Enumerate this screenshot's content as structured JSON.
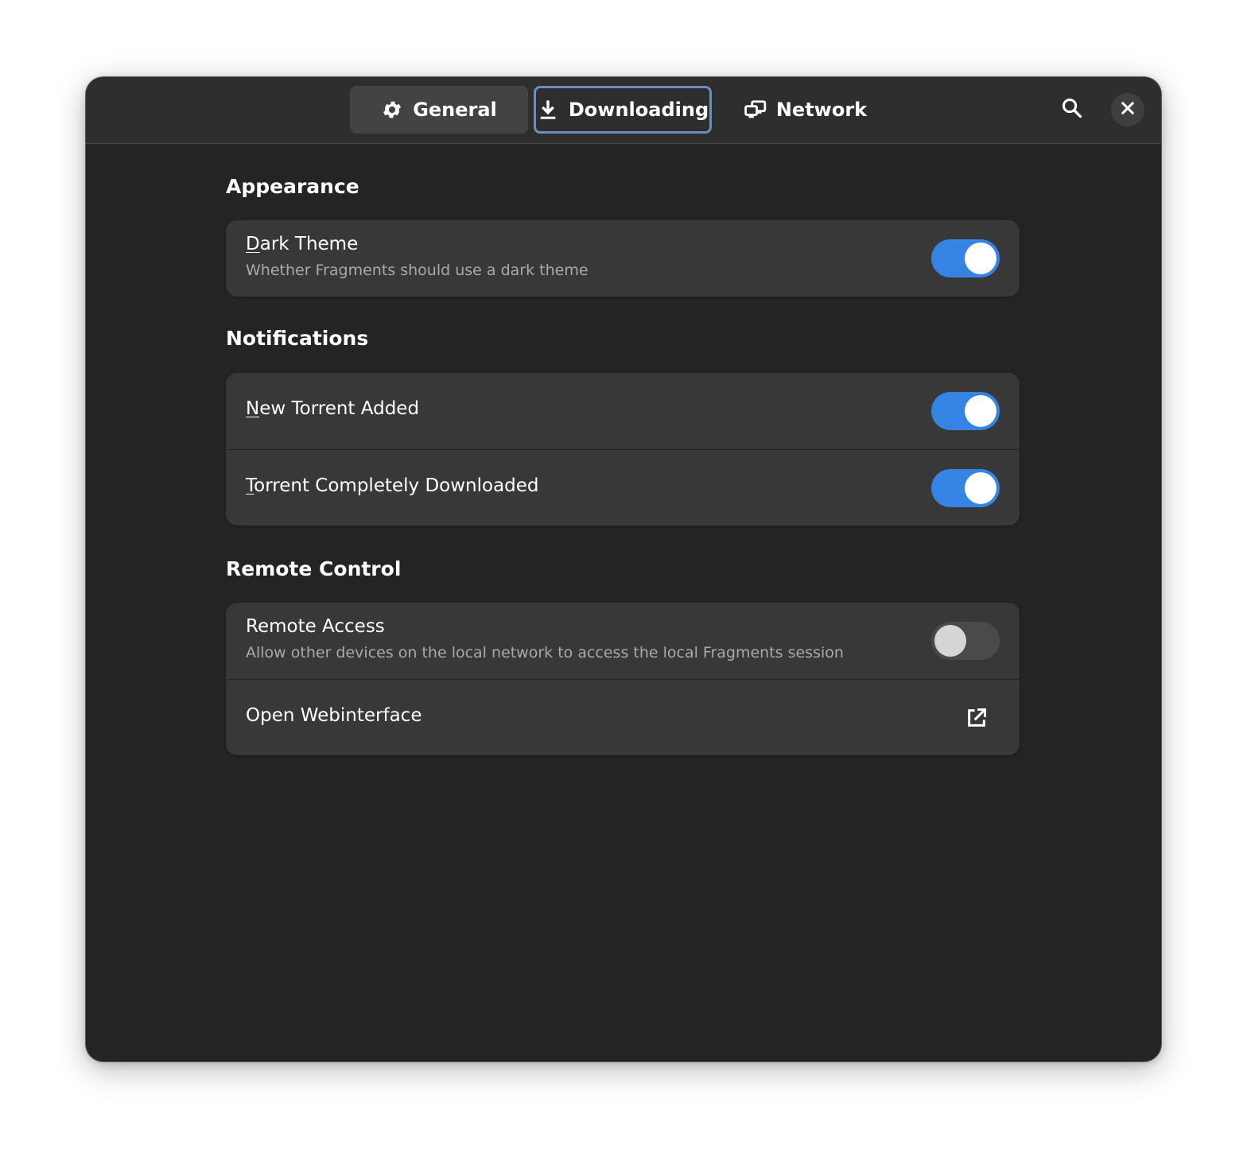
{
  "header": {
    "tabs": [
      {
        "label": "General",
        "icon": "gear-icon",
        "state": "hover"
      },
      {
        "label": "Downloading",
        "icon": "download-icon",
        "state": "focused"
      },
      {
        "label": "Network",
        "icon": "network-icon",
        "state": "normal"
      }
    ],
    "search_icon": "search-icon",
    "close_icon": "close-icon"
  },
  "sections": {
    "appearance": {
      "title": "Appearance",
      "rows": [
        {
          "mnemonic": "D",
          "title_rest": "ark Theme",
          "subtitle": "Whether Fragments should use a dark theme",
          "switch_on": true
        }
      ]
    },
    "notifications": {
      "title": "Notifications",
      "rows": [
        {
          "mnemonic": "N",
          "title_rest": "ew Torrent Added",
          "switch_on": true
        },
        {
          "mnemonic": "T",
          "title_rest": "orrent Completely Downloaded",
          "switch_on": true
        }
      ]
    },
    "remote_control": {
      "title": "Remote Control",
      "rows": [
        {
          "title": "Remote Access",
          "subtitle": "Allow other devices on the local network to access the local Fragments session",
          "switch_on": false
        },
        {
          "title": "Open Webinterface",
          "icon": "external-link-icon"
        }
      ]
    }
  },
  "colors": {
    "accent": "#3584e4",
    "window_bg": "#242424",
    "row_bg": "#383838",
    "header_bg": "#2e2e2e",
    "focus_ring": "#6a8fb9"
  }
}
